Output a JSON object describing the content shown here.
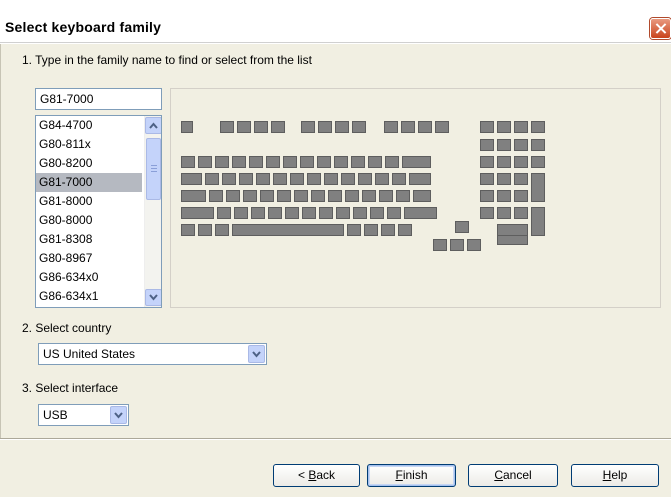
{
  "window": {
    "title": "Select keyboard family"
  },
  "step1": {
    "label": "1.  Type in the family name to find or select from the list",
    "search_value": "G81-7000",
    "list_items": [
      "G84-4700",
      "G80-811x",
      "G80-8200",
      "G81-7000",
      "G81-8000",
      "G80-8000",
      "G81-8308",
      "G80-8967",
      "G86-634x0",
      "G86-634x1"
    ],
    "selected_index": 3
  },
  "step2": {
    "label": "2.  Select country",
    "value": "US United States"
  },
  "step3": {
    "label": "3.  Select interface",
    "value": "USB"
  },
  "buttons": {
    "back_prefix": "< ",
    "back_key": "B",
    "back_rest": "ack",
    "finish_key": "F",
    "finish_rest": "inish",
    "cancel_key": "C",
    "cancel_rest": "ancel",
    "help_key": "H",
    "help_rest": "elp"
  },
  "icons": {
    "close": "close-icon",
    "scroll_up": "scroll-up-arrow-icon",
    "scroll_down": "scroll-down-arrow-icon",
    "dropdown": "chevron-down-icon"
  },
  "colors": {
    "key_fill": "#808080",
    "selection": "#b5b9c1",
    "panel": "#f1efe2"
  }
}
